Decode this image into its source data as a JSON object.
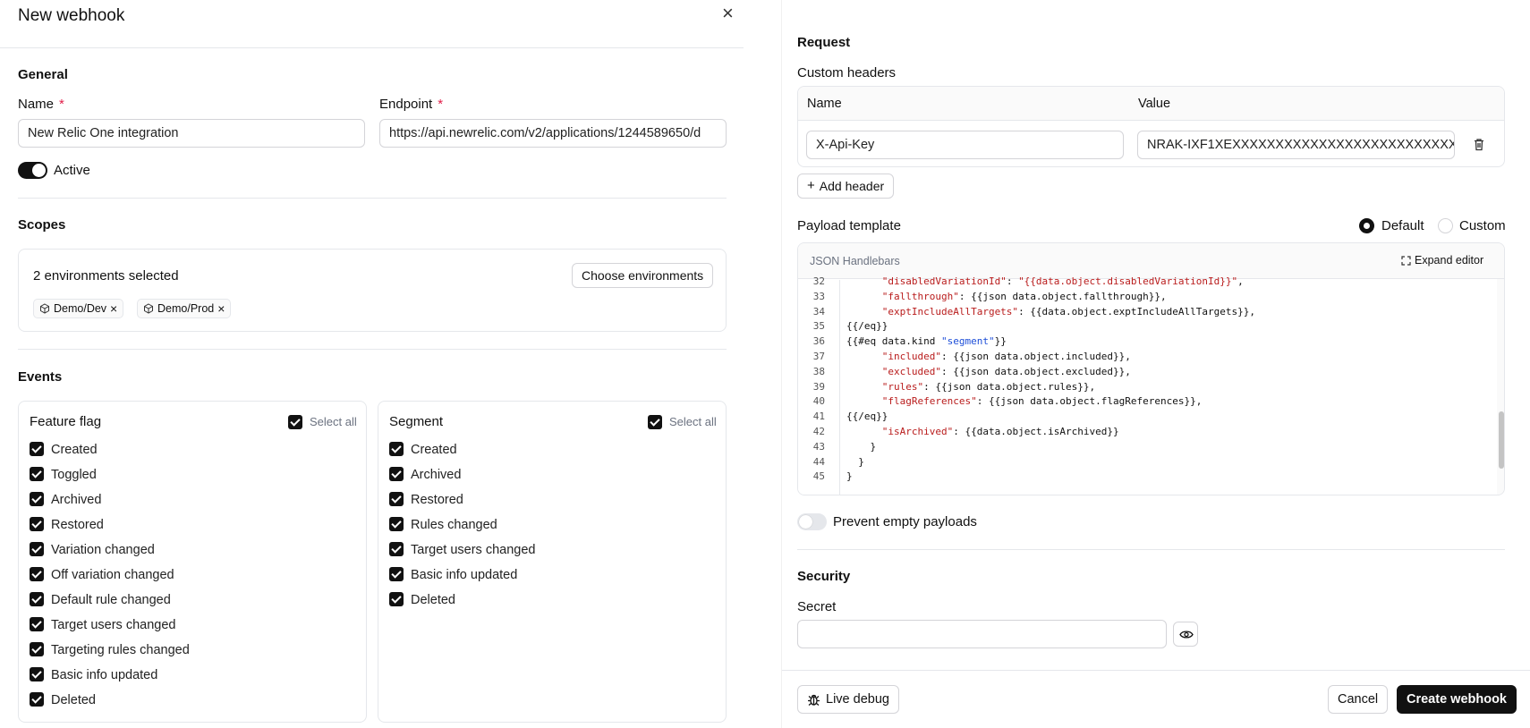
{
  "dialog": {
    "title": "New webhook",
    "close_icon": "×"
  },
  "general": {
    "title": "General",
    "name_label": "Name",
    "endpoint_label": "Endpoint",
    "required_mark": "*",
    "name_value": "New Relic One integration",
    "endpoint_value": "https://api.newrelic.com/v2/applications/1244589650/d",
    "active_label": "Active"
  },
  "scopes": {
    "title": "Scopes",
    "summary": "2 environments selected",
    "choose_button": "Choose environments",
    "chips": [
      "Demo/Dev",
      "Demo/Prod"
    ],
    "chip_remove": "×"
  },
  "events": {
    "title": "Events",
    "select_all": "Select all",
    "feature_flag": {
      "title": "Feature flag",
      "items": [
        "Created",
        "Toggled",
        "Archived",
        "Restored",
        "Variation changed",
        "Off variation changed",
        "Default rule changed",
        "Target users changed",
        "Targeting rules changed",
        "Basic info updated",
        "Deleted"
      ]
    },
    "segment": {
      "title": "Segment",
      "items": [
        "Created",
        "Archived",
        "Restored",
        "Rules changed",
        "Target users changed",
        "Basic info updated",
        "Deleted"
      ]
    }
  },
  "request": {
    "title": "Request",
    "custom_headers": "Custom headers",
    "col_name": "Name",
    "col_value": "Value",
    "header_name": "X-Api-Key",
    "header_value": "NRAK-IXF1XEXXXXXXXXXXXXXXXXXXXXXXXXXX",
    "add_header": "Add header"
  },
  "payload": {
    "title": "Payload template",
    "default_label": "Default",
    "custom_label": "Custom",
    "editor_label": "JSON Handlebars",
    "expand_label": "Expand editor",
    "prevent_empty": "Prevent empty payloads",
    "line_numbers": [
      "32",
      "33",
      "34",
      "35",
      "36",
      "37",
      "38",
      "39",
      "40",
      "41",
      "42",
      "43",
      "44",
      "45"
    ]
  },
  "security": {
    "title": "Security",
    "secret_label": "Secret",
    "secret_value": ""
  },
  "footer": {
    "live_debug": "Live debug",
    "cancel": "Cancel",
    "create": "Create webhook"
  }
}
